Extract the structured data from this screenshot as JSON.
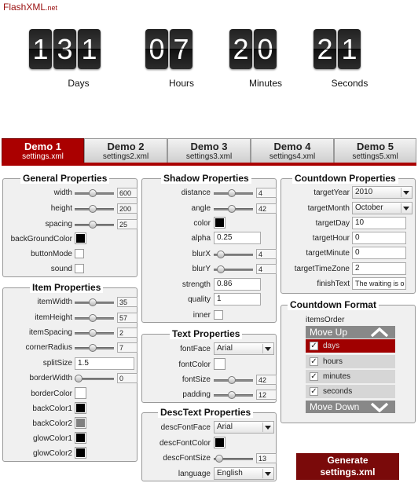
{
  "logo": {
    "part1": "FlashXML",
    "part2": ".net"
  },
  "countdown": {
    "units": [
      {
        "label": "Days",
        "digits": [
          "1",
          "3",
          "1"
        ]
      },
      {
        "label": "Hours",
        "digits": [
          "0",
          "7"
        ]
      },
      {
        "label": "Minutes",
        "digits": [
          "2",
          "0"
        ]
      },
      {
        "label": "Seconds",
        "digits": [
          "2",
          "1"
        ]
      }
    ]
  },
  "tabs": [
    {
      "title": "Demo 1",
      "file": "settings.xml",
      "active": true
    },
    {
      "title": "Demo 2",
      "file": "settings2.xml"
    },
    {
      "title": "Demo 3",
      "file": "settings3.xml"
    },
    {
      "title": "Demo 4",
      "file": "settings4.xml"
    },
    {
      "title": "Demo 5",
      "file": "settings5.xml"
    }
  ],
  "general": {
    "title": "General Properties",
    "width": {
      "label": "width",
      "value": "600",
      "level": 0.45
    },
    "height": {
      "label": "height",
      "value": "200",
      "level": 0.45
    },
    "spacing": {
      "label": "spacing",
      "value": "25",
      "level": 0.45
    },
    "bgcolor": {
      "label": "backGroundColor",
      "color": "#000000"
    },
    "buttonMode": {
      "label": "buttonMode",
      "checked": false
    },
    "sound": {
      "label": "sound",
      "checked": false
    }
  },
  "item": {
    "title": "Item Properties",
    "itemWidth": {
      "label": "itemWidth",
      "value": "35",
      "level": 0.45
    },
    "itemHeight": {
      "label": "itemHeight",
      "value": "57",
      "level": 0.45
    },
    "itemSpacing": {
      "label": "itemSpacing",
      "value": "2",
      "level": 0.45
    },
    "cornerRadius": {
      "label": "cornerRadius",
      "value": "7",
      "level": 0.45
    },
    "splitSize": {
      "label": "splitSize",
      "value": "1.5"
    },
    "borderWidth": {
      "label": "borderWidth",
      "value": "0",
      "level": 0.0
    },
    "borderColor": {
      "label": "borderColor",
      "color": "#ffffff"
    },
    "backColor1": {
      "label": "backColor1",
      "color": "#000000"
    },
    "backColor2": {
      "label": "backColor2",
      "color": "#808080"
    },
    "glowColor1": {
      "label": "glowColor1",
      "color": "#000000"
    },
    "glowColor2": {
      "label": "glowColor2",
      "color": "#000000"
    }
  },
  "shadow": {
    "title": "Shadow Properties",
    "distance": {
      "label": "distance",
      "value": "4",
      "level": 0.45
    },
    "angle": {
      "label": "angle",
      "value": "42",
      "level": 0.45
    },
    "color": {
      "label": "color",
      "color": "#000000"
    },
    "alpha": {
      "label": "alpha",
      "value": "0.25"
    },
    "blurX": {
      "label": "blurX",
      "value": "4",
      "level": 0.1
    },
    "blurY": {
      "label": "blurY",
      "value": "4",
      "level": 0.1
    },
    "strength": {
      "label": "strength",
      "value": "0.86"
    },
    "quality": {
      "label": "quality",
      "value": "1"
    },
    "inner": {
      "label": "inner",
      "checked": false
    }
  },
  "text": {
    "title": "Text Properties",
    "fontFace": {
      "label": "fontFace",
      "value": "Arial"
    },
    "fontColor": {
      "label": "fontColor",
      "color": "#ffffff"
    },
    "fontSize": {
      "label": "fontSize",
      "value": "42",
      "level": 0.45
    },
    "padding": {
      "label": "padding",
      "value": "12",
      "level": 0.45
    }
  },
  "desc": {
    "title": "DescText Properties",
    "descFontFace": {
      "label": "descFontFace",
      "value": "Arial"
    },
    "descFontColor": {
      "label": "descFontColor",
      "color": "#000000"
    },
    "descFontSize": {
      "label": "descFontSize",
      "value": "13",
      "level": 0.05
    },
    "language": {
      "label": "language",
      "value": "English"
    }
  },
  "countdownProps": {
    "title": "Countdown Properties",
    "targetYear": {
      "label": "targetYear",
      "value": "2010"
    },
    "targetMonth": {
      "label": "targetMonth",
      "value": "October"
    },
    "targetDay": {
      "label": "targetDay",
      "value": "10"
    },
    "targetHour": {
      "label": "targetHour",
      "value": "0"
    },
    "targetMinute": {
      "label": "targetMinute",
      "value": "0"
    },
    "targetTimeZone": {
      "label": "targetTimeZone",
      "value": "2"
    },
    "finishText": {
      "label": "finishText",
      "value": "The waiting is o"
    }
  },
  "format": {
    "title": "Countdown Format",
    "itemsOrderLabel": "itemsOrder",
    "moveUp": "Move Up",
    "moveDown": "Move Down",
    "items": [
      {
        "label": "days",
        "checked": true,
        "selected": true
      },
      {
        "label": "hours",
        "checked": true
      },
      {
        "label": "minutes",
        "checked": true
      },
      {
        "label": "seconds",
        "checked": true
      }
    ]
  },
  "generate": {
    "line1": "Generate",
    "line2": "settings.xml"
  },
  "colors": {
    "accent": "#aa0000",
    "button": "#7a0a0a"
  }
}
